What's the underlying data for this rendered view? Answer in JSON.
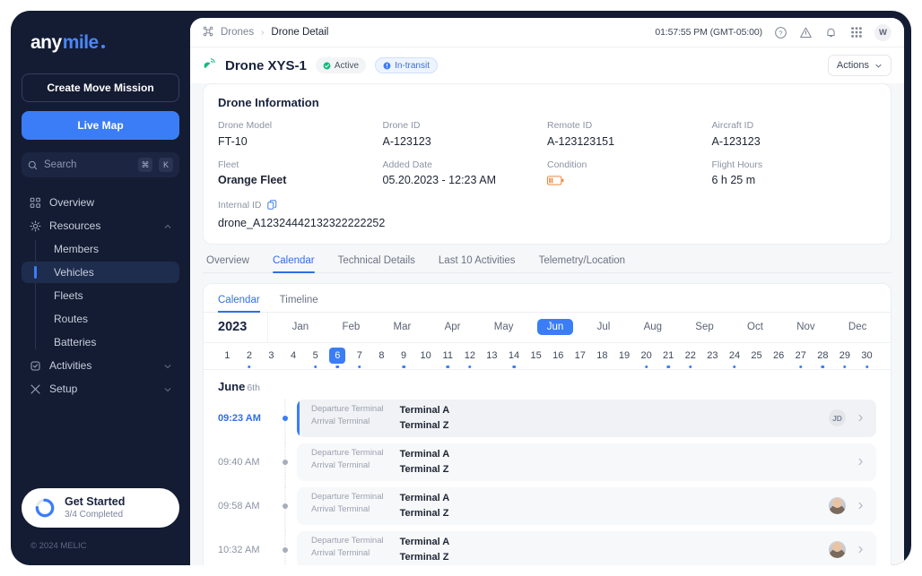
{
  "sidebar": {
    "logo": {
      "part1": "any",
      "part2": "mile"
    },
    "create_button": "Create Move Mission",
    "livemap_button": "Live Map",
    "search": {
      "placeholder": "Search",
      "key1": "⌘",
      "key2": "K"
    },
    "nav": [
      {
        "label": "Overview",
        "icon": "grid-icon"
      },
      {
        "label": "Resources",
        "icon": "resources-icon"
      },
      {
        "label": "Activities",
        "icon": "clipboard-icon"
      },
      {
        "label": "Setup",
        "icon": "tools-icon"
      }
    ],
    "sub_items": [
      {
        "label": "Members"
      },
      {
        "label": "Vehicles"
      },
      {
        "label": "Fleets"
      },
      {
        "label": "Routes"
      },
      {
        "label": "Batteries"
      }
    ],
    "get_started": {
      "title": "Get Started",
      "subtitle": "3/4 Completed",
      "progress": 75
    },
    "footer": "© 2024 MELIC"
  },
  "topbar": {
    "breadcrumb_root": "Drones",
    "breadcrumb_current": "Drone Detail",
    "clock": "01:57:55 PM (GMT-05:00)",
    "avatar": "W"
  },
  "title": {
    "name": "Drone XYS-1",
    "badge_active": "Active",
    "badge_transit": "In-transit",
    "actions": "Actions"
  },
  "info": {
    "heading": "Drone Information",
    "fields": [
      {
        "label": "Drone Model",
        "value": "FT-10"
      },
      {
        "label": "Drone ID",
        "value": "A-123123"
      },
      {
        "label": "Remote ID",
        "value": "A-123123151"
      },
      {
        "label": "Aircraft ID",
        "value": "A-123123"
      },
      {
        "label": "Fleet",
        "value": "Orange Fleet"
      },
      {
        "label": "Added Date",
        "value": "05.20.2023 - 12:23 AM"
      },
      {
        "label": "Condition",
        "value": ""
      },
      {
        "label": "Flight Hours",
        "value": "6 h 25 m"
      }
    ],
    "internal_id_label": "Internal ID",
    "internal_id_value": "drone_A12324442132322222252"
  },
  "tabs": [
    {
      "label": "Overview"
    },
    {
      "label": "Calendar"
    },
    {
      "label": "Technical Details"
    },
    {
      "label": "Last 10 Activities"
    },
    {
      "label": "Telemetry/Location"
    }
  ],
  "calendar": {
    "subtabs": [
      {
        "label": "Calendar"
      },
      {
        "label": "Timeline"
      }
    ],
    "year": "2023",
    "months": [
      "Jan",
      "Feb",
      "Mar",
      "Apr",
      "May",
      "Jun",
      "Jul",
      "Aug",
      "Sep",
      "Oct",
      "Nov",
      "Dec"
    ],
    "selected_month": "Jun",
    "days": [
      {
        "n": "1",
        "dot": false
      },
      {
        "n": "2",
        "dot": true
      },
      {
        "n": "3",
        "dot": false
      },
      {
        "n": "4",
        "dot": false
      },
      {
        "n": "5",
        "dot": true
      },
      {
        "n": "6",
        "dot": true
      },
      {
        "n": "7",
        "dot": true
      },
      {
        "n": "8",
        "dot": false
      },
      {
        "n": "9",
        "dot": true
      },
      {
        "n": "10",
        "dot": false
      },
      {
        "n": "11",
        "dot": true
      },
      {
        "n": "12",
        "dot": true
      },
      {
        "n": "13",
        "dot": false
      },
      {
        "n": "14",
        "dot": true
      },
      {
        "n": "15",
        "dot": false
      },
      {
        "n": "16",
        "dot": false
      },
      {
        "n": "17",
        "dot": false
      },
      {
        "n": "18",
        "dot": false
      },
      {
        "n": "19",
        "dot": false
      },
      {
        "n": "20",
        "dot": true
      },
      {
        "n": "21",
        "dot": true
      },
      {
        "n": "22",
        "dot": true
      },
      {
        "n": "23",
        "dot": false
      },
      {
        "n": "24",
        "dot": true
      },
      {
        "n": "25",
        "dot": false
      },
      {
        "n": "26",
        "dot": false
      },
      {
        "n": "27",
        "dot": true
      },
      {
        "n": "28",
        "dot": true
      },
      {
        "n": "29",
        "dot": true
      },
      {
        "n": "30",
        "dot": true
      }
    ],
    "selected_day": "6",
    "day_header_month": "June",
    "day_header_ord": "6th",
    "departure_label": "Departure Terminal",
    "arrival_label": "Arrival Terminal",
    "entries": [
      {
        "time": "09:23 AM",
        "departure": "Terminal A",
        "arrival": "Terminal Z",
        "avatar": "JD",
        "avatar_type": "initials",
        "selected": true
      },
      {
        "time": "09:40 AM",
        "departure": "Terminal A",
        "arrival": "Terminal Z",
        "avatar": "",
        "avatar_type": "none",
        "selected": false
      },
      {
        "time": "09:58 AM",
        "departure": "Terminal A",
        "arrival": "Terminal Z",
        "avatar": "",
        "avatar_type": "photo",
        "selected": false
      },
      {
        "time": "10:32 AM",
        "departure": "Terminal A",
        "arrival": "Terminal Z",
        "avatar": "",
        "avatar_type": "photo",
        "selected": false
      }
    ]
  },
  "colors": {
    "accent": "#3b7df6",
    "sidebar_bg": "#141c33",
    "green": "#16b97f",
    "orange": "#f2863c"
  }
}
